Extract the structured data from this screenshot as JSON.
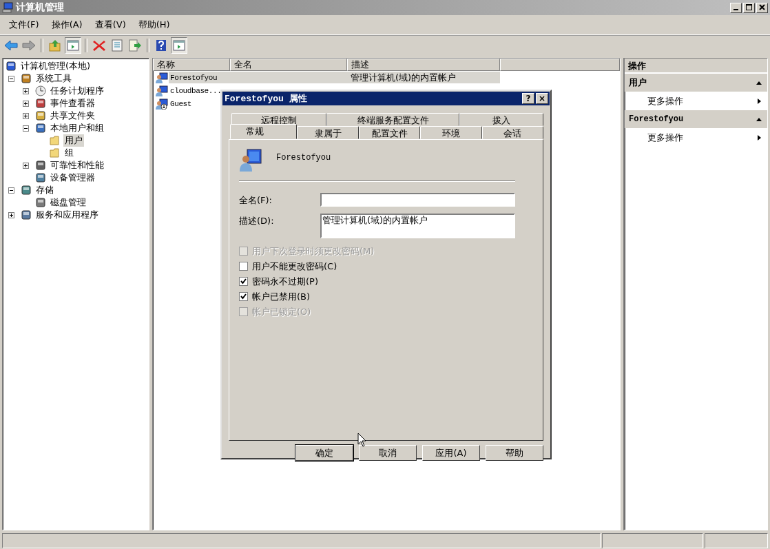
{
  "window": {
    "title": "计算机管理"
  },
  "menu": [
    "文件(F)",
    "操作(A)",
    "查看(V)",
    "帮助(H)"
  ],
  "toolbar": [
    {
      "kind": "back"
    },
    {
      "kind": "forward"
    },
    {
      "kind": "sep"
    },
    {
      "kind": "up"
    },
    {
      "kind": "tree"
    },
    {
      "kind": "sep"
    },
    {
      "kind": "delete"
    },
    {
      "kind": "properties"
    },
    {
      "kind": "export"
    },
    {
      "kind": "sep"
    },
    {
      "kind": "help"
    },
    {
      "kind": "pane"
    }
  ],
  "tree": [
    {
      "label": "计算机管理(本地)",
      "kind": "computer",
      "selected": false,
      "children": [
        {
          "label": "系统工具",
          "kind": "tools",
          "expanded": true,
          "selected": false,
          "children": [
            {
              "label": "任务计划程序",
              "kind": "clock",
              "expanded": false,
              "selected": false
            },
            {
              "label": "事件查看器",
              "kind": "log",
              "expanded": false,
              "selected": false
            },
            {
              "label": "共享文件夹",
              "kind": "share",
              "expanded": false,
              "selected": false
            },
            {
              "label": "本地用户和组",
              "kind": "users",
              "expanded": true,
              "selected": false,
              "children": [
                {
                  "label": "用户",
                  "kind": "folder",
                  "selected": true
                },
                {
                  "label": "组",
                  "kind": "folder",
                  "selected": false
                }
              ]
            },
            {
              "label": "可靠性和性能",
              "kind": "gauge",
              "expanded": false,
              "selected": false
            },
            {
              "label": "设备管理器",
              "kind": "device",
              "selected": false
            }
          ]
        },
        {
          "label": "存储",
          "kind": "storage",
          "expanded": true,
          "selected": false,
          "children": [
            {
              "label": "磁盘管理",
              "kind": "disk",
              "selected": false
            }
          ]
        },
        {
          "label": "服务和应用程序",
          "kind": "services",
          "expanded": false,
          "selected": false
        }
      ]
    }
  ],
  "list": {
    "columns": [
      "名称",
      "全名",
      "描述"
    ],
    "rows": [
      {
        "name": "Forestofyou",
        "description": "管理计算机(域)的内置帐户",
        "selected": true,
        "disabled": false
      },
      {
        "name": "cloudbase...",
        "selected": false,
        "disabled": false
      },
      {
        "name": "Guest",
        "selected": false,
        "disabled": true
      }
    ]
  },
  "actions": {
    "title": "操作",
    "sections": [
      {
        "title": "用户",
        "expanded": true,
        "items": [
          "更多操作"
        ]
      },
      {
        "title": "Forestofyou",
        "expanded": true,
        "items": [
          "更多操作"
        ]
      }
    ]
  },
  "dialog": {
    "title": "Forestofyou 属性",
    "help": "?",
    "close": "×",
    "tab_rows": [
      [
        {
          "label": "远程控制",
          "selected": false
        },
        {
          "label": "终端服务配置文件",
          "selected": false
        },
        {
          "label": "拨入",
          "selected": false
        }
      ],
      [
        {
          "label": "常规",
          "selected": true
        },
        {
          "label": "隶属于",
          "selected": false
        },
        {
          "label": "配置文件",
          "selected": false
        },
        {
          "label": "环境",
          "selected": false
        },
        {
          "label": "会话",
          "selected": false
        }
      ]
    ],
    "user_name": "Forestofyou",
    "fields": [
      {
        "label": "全名(F):",
        "multiline": false
      },
      {
        "label": "描述(D):",
        "value": "管理计算机(域)的内置帐户",
        "multiline": true
      }
    ],
    "checks": [
      {
        "label": "用户下次登录时须更改密码(M)",
        "checked": false,
        "disabled": true
      },
      {
        "label": "用户不能更改密码(C)",
        "checked": false,
        "disabled": false
      },
      {
        "label": "密码永不过期(P)",
        "checked": true,
        "disabled": false
      },
      {
        "label": "帐户已禁用(B)",
        "checked": true,
        "disabled": false
      },
      {
        "label": "帐户已锁定(O)",
        "checked": false,
        "disabled": true
      }
    ],
    "buttons": [
      {
        "label": "确定",
        "default": true
      },
      {
        "label": "取消",
        "default": false
      },
      {
        "label": "应用(A)",
        "default": false
      },
      {
        "label": "帮助",
        "default": false
      }
    ]
  }
}
